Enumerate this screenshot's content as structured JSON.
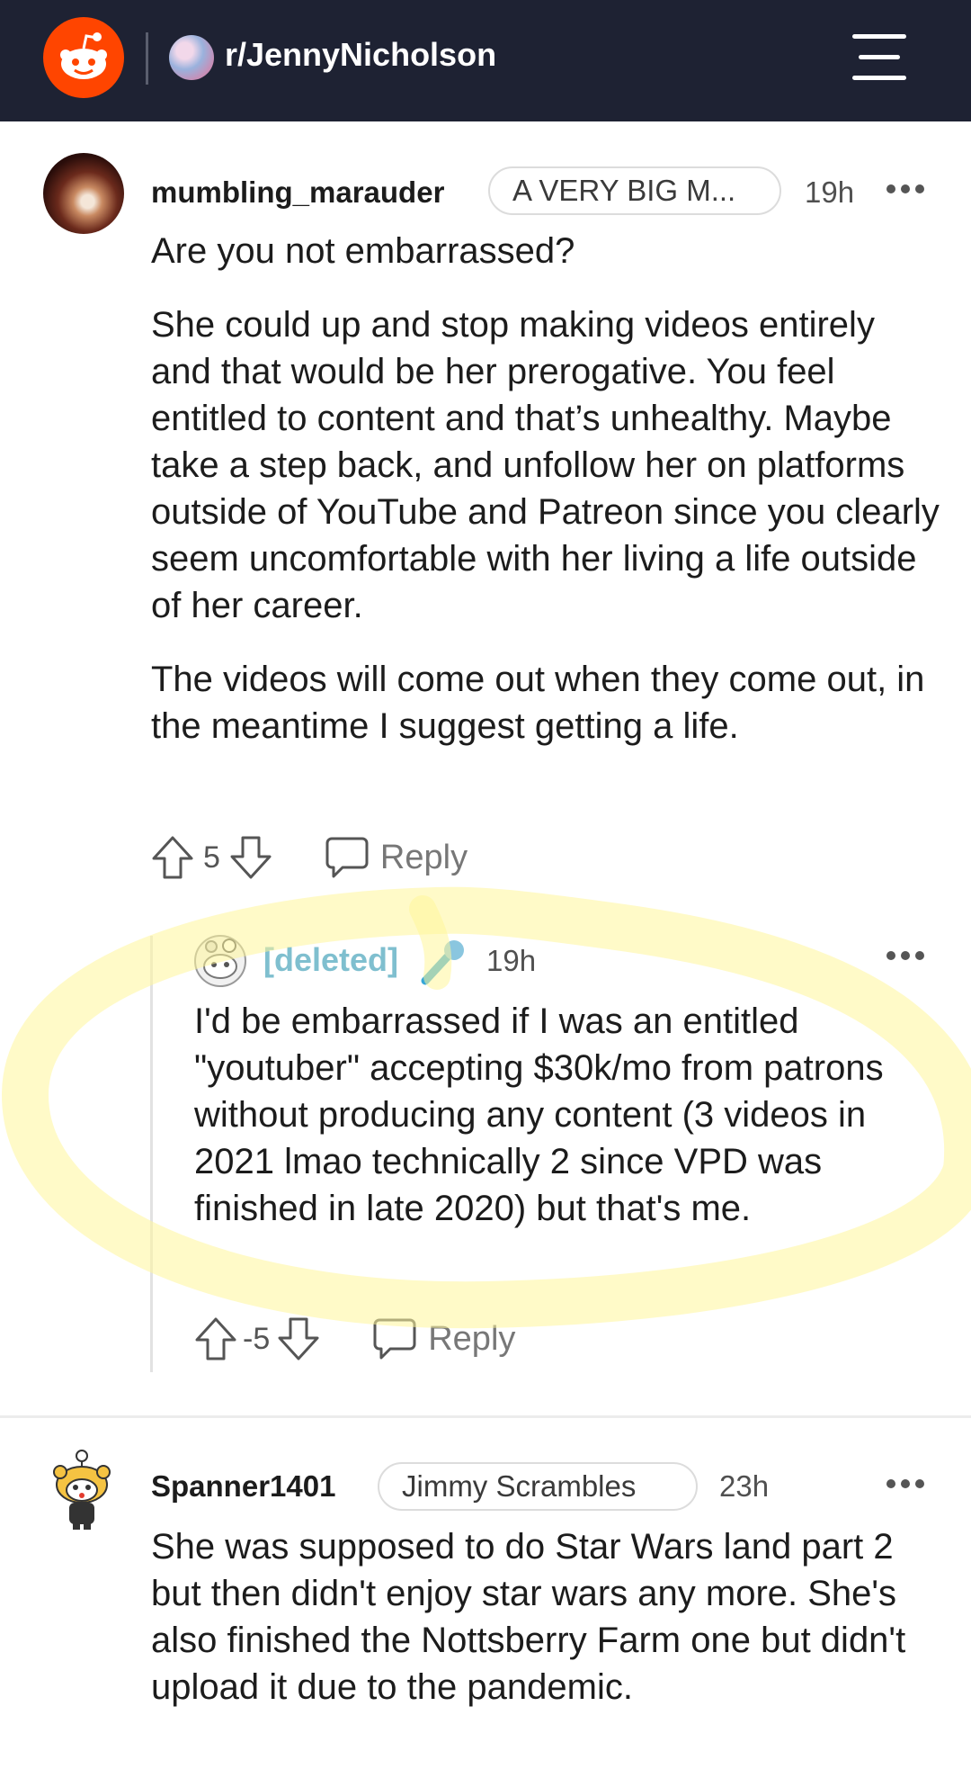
{
  "header": {
    "subreddit": "r/JennyNicholson",
    "logo_icon": "reddit-logo-icon",
    "menu_icon": "hamburger-menu-icon"
  },
  "comments": [
    {
      "username": "mumbling_marauder",
      "flair": "A VERY BIG M...",
      "time": "19h",
      "paragraphs": [
        "Are you not embarrassed?",
        "She could up and stop making videos entirely and that would be her prerogative. You feel entitled to content and that’s unhealthy. Maybe take a step back, and unfollow her on platforms outside of YouTube and Patreon since you clearly seem uncomfortable with her living a life outside of her career.",
        "The videos will come out when they come out, in the meantime I suggest getting a life."
      ],
      "score": "5",
      "reply_label": "Reply"
    },
    {
      "username": "[deleted]",
      "time": "19h",
      "body": "I'd be embarrassed if I was an entitled \"youtuber\" accepting $30k/mo from patrons without producing any content (3 videos in 2021 lmao technically 2 since VPD was finished in late 2020) but that's me.",
      "score": "-5",
      "reply_label": "Reply",
      "badge_icon": "microphone-icon"
    },
    {
      "username": "Spanner1401",
      "flair": "Jimmy Scrambles",
      "time": "23h",
      "body": "She was supposed to do Star Wars land part 2 but then didn't enjoy star wars any more. She's also finished the Nottsberry Farm one but didn't upload it due to the pandemic."
    }
  ],
  "colors": {
    "header_bg": "#1e2233",
    "reddit_orange": "#ff4500",
    "deleted_name": "#7fbfcf",
    "highlight": "#fff7a8"
  }
}
